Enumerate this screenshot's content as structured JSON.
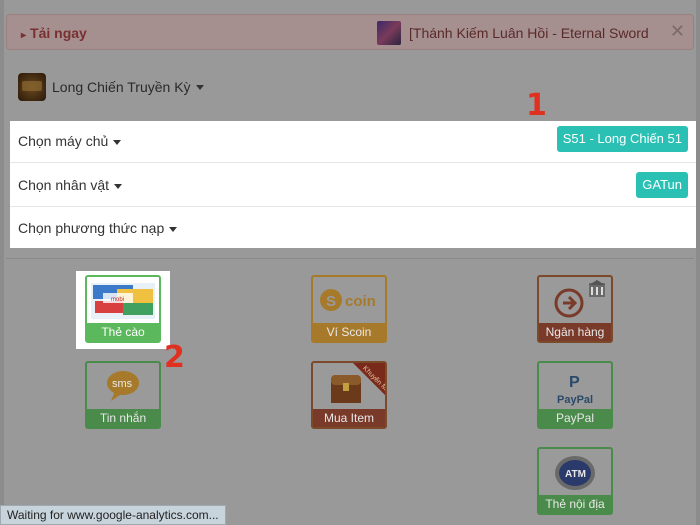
{
  "banner": {
    "download_label": "Tải ngay",
    "game_title": "[Thánh Kiếm Luân Hồi - Eternal Sword",
    "close_glyph": "✕"
  },
  "game": {
    "name": "Long Chiến Truyền Kỳ"
  },
  "selection": {
    "server_label": "Chọn máy chủ",
    "server_value": "S51 - Long Chiến 51",
    "character_label": "Chọn nhân vật",
    "character_value": "GATun",
    "method_label": "Chọn phương thức nạp"
  },
  "steps": {
    "one": "1",
    "two": "2"
  },
  "payment_methods": [
    {
      "label": "Thẻ cào",
      "icon": "scratch-card-icon"
    },
    {
      "label": "Ví Scoin",
      "icon": "scoin-icon",
      "icon_text": "coin"
    },
    {
      "label": "Ngân hàng",
      "icon": "bank-icon"
    },
    {
      "label": "Tin nhắn",
      "icon": "sms-icon",
      "icon_text": "sms"
    },
    {
      "label": "Mua Item",
      "icon": "treasure-chest-icon",
      "icon_text": "Khuyến Mãi"
    },
    {
      "label": "PayPal",
      "icon": "paypal-icon",
      "icon_text": "PayPal"
    },
    {
      "label": "Thẻ nội địa",
      "icon": "atm-card-icon",
      "icon_text": "ATM"
    }
  ],
  "status_bar": {
    "text": "Waiting for www.google-analytics.com..."
  },
  "colors": {
    "accent": "#2bc0b4",
    "step_number": "#e03020"
  }
}
